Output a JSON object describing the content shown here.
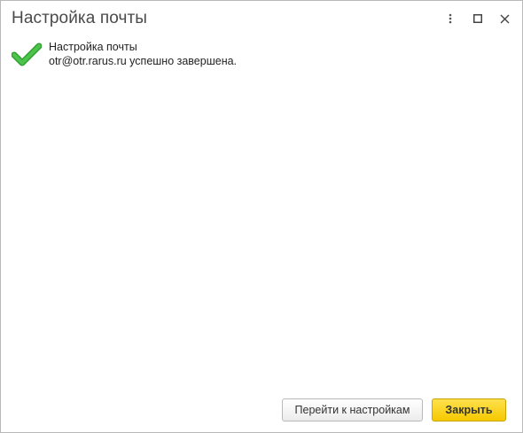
{
  "window": {
    "title": "Настройка почты"
  },
  "titlebar": {
    "more_icon": "vertical-ellipsis-icon",
    "maximize_icon": "maximize-square-icon",
    "close_icon": "close-x-icon"
  },
  "message": {
    "icon": "green-checkmark-icon",
    "line1": "Настройка почты",
    "line2": "otr@otr.rarus.ru успешно завершена."
  },
  "buttons": {
    "settings_label": "Перейти к настройкам",
    "close_label": "Закрыть"
  },
  "colors": {
    "accent_button": "#F5C800",
    "check_green": "#3DB33D",
    "title_text": "#4A4A4A"
  }
}
